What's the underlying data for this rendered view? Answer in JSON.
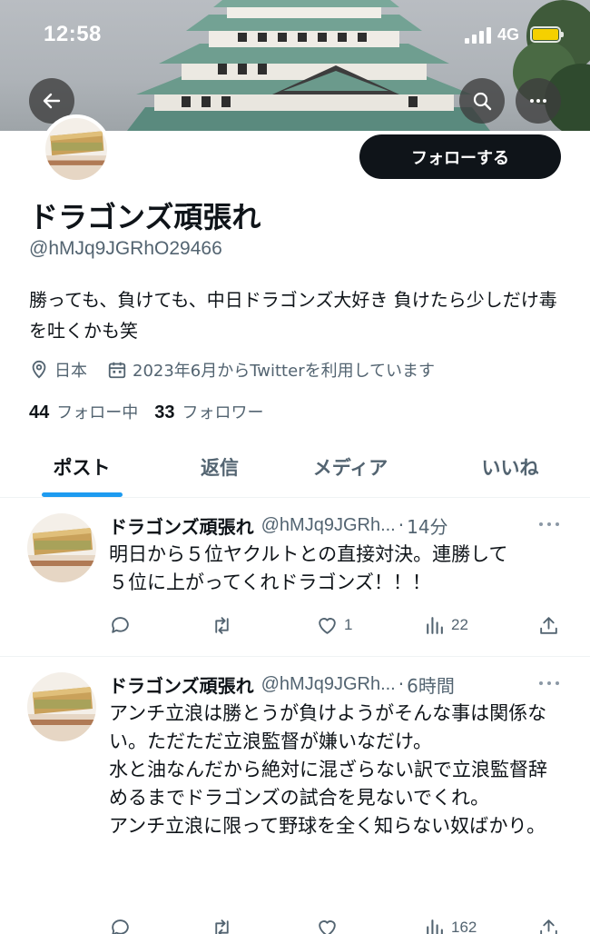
{
  "status_bar": {
    "time": "12:58",
    "network": "4G"
  },
  "profile": {
    "follow_label": "フォローする",
    "display_name": "ドラゴンズ頑張れ",
    "handle": "@hMJq9JGRhO29466",
    "bio": "勝っても、負けても、中日ドラゴンズ大好き 負けたら少しだけ毒を吐くかも笑",
    "location": "日本",
    "joined": "2023年6月からTwitterを利用しています",
    "following_count": "44",
    "following_label": "フォロー中",
    "followers_count": "33",
    "followers_label": "フォロワー"
  },
  "tabs": [
    {
      "label": "ポスト",
      "active": true
    },
    {
      "label": "返信",
      "active": false
    },
    {
      "label": "メディア",
      "active": false
    },
    {
      "label": "いいね",
      "active": false
    }
  ],
  "tweets": [
    {
      "name": "ドラゴンズ頑張れ",
      "handle": "@hMJq9JGRh...",
      "separator": "·",
      "time": "14分",
      "text": "明日から５位ヤクルトとの直接対決。連勝して\n５位に上がってくれドラゴンズ！！！",
      "likes": "1",
      "views": "22"
    },
    {
      "name": "ドラゴンズ頑張れ",
      "handle": "@hMJq9JGRh...",
      "separator": "·",
      "time": "6時間",
      "text": "アンチ立浪は勝とうが負けようがそんな事は関係ない。ただただ立浪監督が嫌いなだけ。\n水と油なんだから絶対に混ざらない訳で立浪監督辞めるまでドラゴンズの試合を見ないでくれ。\nアンチ立浪に限って野球を全く知らない奴ばかり。",
      "likes": "",
      "views": "162"
    }
  ],
  "colors": {
    "accent": "#1d9bf0",
    "text": "#0f1419",
    "secondary": "#536471",
    "battery": "#f5d000"
  }
}
